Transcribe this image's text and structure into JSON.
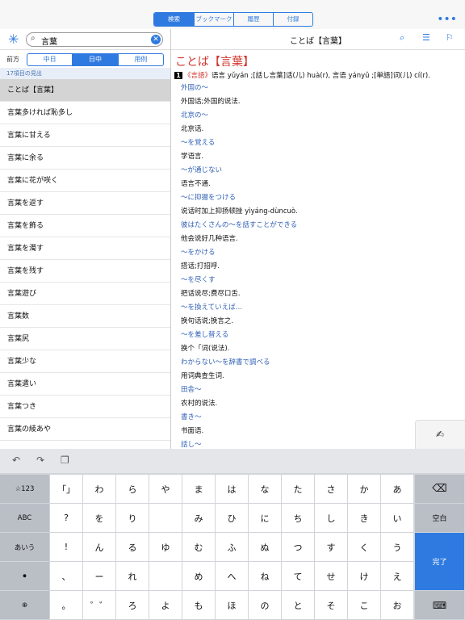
{
  "top_tabs": [
    "検索",
    "ブックマーク",
    "履歴",
    "付録"
  ],
  "more_icon": "ellipsis-icon",
  "search": {
    "query": "言葉",
    "clear_icon": "clear-icon"
  },
  "mode": {
    "label": "前方",
    "options": [
      "中日",
      "日中",
      "用例"
    ],
    "selected": 1
  },
  "result_count": "17項目の見出",
  "results": [
    "ことば【言葉】",
    "言葉多ければ恥多し",
    "言葉に甘える",
    "言葉に余る",
    "言葉に花が咲く",
    "言葉を返す",
    "言葉を飾る",
    "言葉を濁す",
    "言葉を残す",
    "言葉遊び",
    "言葉数",
    "言葉尻",
    "言葉少な",
    "言葉遣い",
    "言葉つき",
    "言葉の綾あや"
  ],
  "entry": {
    "header_title": "ことば【言葉】",
    "title": "ことば【言葉】",
    "definition": {
      "number": "1",
      "pos": "《言語》",
      "text": "语言 yǔyán ;[話し言葉]话(儿) huà(r), 言语 yányǔ ;[単語]词(儿) cí(r)."
    },
    "examples": [
      {
        "jp": "外国の〜",
        "cn": "外国话;外国的说法."
      },
      {
        "jp": "北京の〜",
        "cn": "北京话."
      },
      {
        "jp": "〜を覚える",
        "cn": "学语言."
      },
      {
        "jp": "〜が通じない",
        "cn": "语言不通."
      },
      {
        "jp": "〜に抑揚をつける",
        "cn": "说话时加上抑扬顿挫 yìyáng-dùncuò."
      },
      {
        "jp": "彼はたくさんの〜を話すことができる",
        "cn": "他会说好几种语言."
      },
      {
        "jp": "〜をかける",
        "cn": "搭话;打招呼."
      },
      {
        "jp": "〜を尽くす",
        "cn": "把话说尽;费尽口舌."
      },
      {
        "jp": "〜を換えていえば…",
        "cn": "换句话说;换言之."
      },
      {
        "jp": "〜を差し替える",
        "cn": "换个「词(说法)."
      },
      {
        "jp": "わからない〜を辞書で調べる",
        "cn": "用词典查生词."
      },
      {
        "jp": "田舎〜",
        "cn": "农村的说法."
      },
      {
        "jp": "書き〜",
        "cn": "书面语."
      },
      {
        "jp": "話し〜",
        "cn": ""
      }
    ]
  },
  "keyboard": {
    "left_keys": [
      "☆123",
      "ABC",
      "あいう",
      "mic-icon",
      "globe-icon"
    ],
    "rows": [
      [
        "「」",
        "わ",
        "ら",
        "や",
        "ま",
        "は",
        "な",
        "た",
        "さ",
        "か",
        "あ"
      ],
      [
        "?",
        "を",
        "り",
        "",
        "み",
        "ひ",
        "に",
        "ち",
        "し",
        "き",
        "い"
      ],
      [
        "!",
        "ん",
        "る",
        "ゆ",
        "む",
        "ふ",
        "ぬ",
        "つ",
        "す",
        "く",
        "う"
      ],
      [
        "、",
        "ー",
        "れ",
        "",
        "め",
        "へ",
        "ね",
        "て",
        "せ",
        "け",
        "え"
      ],
      [
        "。",
        "゜゛",
        "ろ",
        "よ",
        "も",
        "ほ",
        "の",
        "と",
        "そ",
        "こ",
        "お"
      ]
    ],
    "space_label": "空白",
    "done_label": "完了"
  }
}
